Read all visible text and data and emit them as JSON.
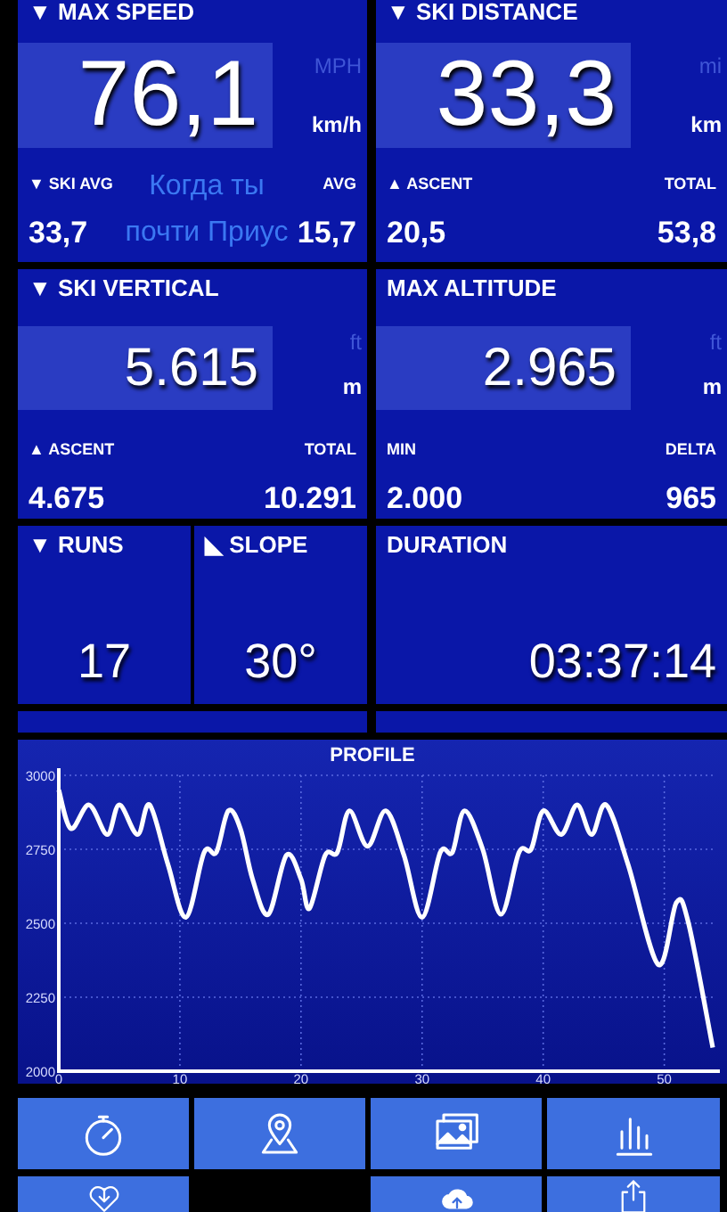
{
  "tiles": [
    {
      "label": "▼ MAX SPEED",
      "value": "76,1",
      "units": [
        {
          "text": "MPH",
          "selected": false
        },
        {
          "text": "km/h",
          "selected": true
        }
      ],
      "stats": [
        {
          "label": "▼ SKI AVG",
          "value": "33,7"
        },
        {
          "label": "AVG",
          "value": "15,7"
        }
      ]
    },
    {
      "label": "▼ SKI DISTANCE",
      "value": "33,3",
      "units": [
        {
          "text": "mi",
          "selected": false
        },
        {
          "text": "km",
          "selected": true
        }
      ],
      "stats": [
        {
          "label": "▲ ASCENT",
          "value": "20,5"
        },
        {
          "label": "TOTAL",
          "value": "53,8"
        }
      ]
    },
    {
      "label": "▼ SKI VERTICAL",
      "value": "5.615",
      "units": [
        {
          "text": "ft",
          "selected": false
        },
        {
          "text": "m",
          "selected": true
        }
      ],
      "stats": [
        {
          "label": "▲ ASCENT",
          "value": "4.675"
        },
        {
          "label": "TOTAL",
          "value": "10.291"
        }
      ]
    },
    {
      "label": "MAX ALTITUDE",
      "value": "2.965",
      "units": [
        {
          "text": "ft",
          "selected": false
        },
        {
          "text": "m",
          "selected": true
        }
      ],
      "stats": [
        {
          "label": "MIN",
          "value": "2.000"
        },
        {
          "label": "DELTA",
          "value": "965"
        }
      ]
    }
  ],
  "caption": [
    "Когда ты",
    "почти Приус"
  ],
  "small_tiles": [
    {
      "label": "▼ RUNS",
      "value": "17"
    },
    {
      "label": "◣ SLOPE",
      "value": "30°"
    },
    {
      "label": "DURATION",
      "value": "03:37:14"
    }
  ],
  "profile": {
    "title": "PROFILE",
    "chart_data": {
      "type": "line",
      "x": [
        0,
        1,
        2.5,
        4,
        5,
        6.5,
        7.5,
        9,
        10.5,
        12,
        13,
        14,
        15,
        16,
        17.3,
        18.8,
        20,
        20.7,
        22,
        23,
        24,
        25.5,
        27,
        28.5,
        30,
        31.5,
        32.5,
        33.5,
        35,
        36.5,
        38,
        39,
        40,
        41.5,
        42.8,
        44,
        45.2,
        47,
        49.5,
        51,
        52,
        54
      ],
      "series": [
        {
          "color": "#ffffff",
          "values": [
            2950,
            2820,
            2900,
            2800,
            2900,
            2800,
            2900,
            2700,
            2520,
            2740,
            2740,
            2880,
            2820,
            2650,
            2530,
            2730,
            2650,
            2550,
            2730,
            2740,
            2880,
            2760,
            2880,
            2730,
            2520,
            2740,
            2740,
            2880,
            2750,
            2530,
            2740,
            2750,
            2880,
            2800,
            2900,
            2800,
            2900,
            2700,
            2360,
            2570,
            2500,
            2080
          ]
        }
      ],
      "grid": true,
      "xlim": [
        0,
        54
      ],
      "ylim": [
        2000,
        3000
      ],
      "xticks": [
        0,
        10,
        20,
        30,
        40,
        50
      ],
      "yticks": [
        2000,
        2250,
        2500,
        2750,
        3000
      ]
    }
  },
  "toolbar": [
    {
      "kind": "stopwatch"
    },
    {
      "kind": "map-pin"
    },
    {
      "kind": "photos"
    },
    {
      "kind": "bar-chart"
    },
    {
      "kind": "heart-download"
    },
    {
      "kind": "empty"
    },
    {
      "kind": "cloud-upload"
    },
    {
      "kind": "share"
    }
  ]
}
